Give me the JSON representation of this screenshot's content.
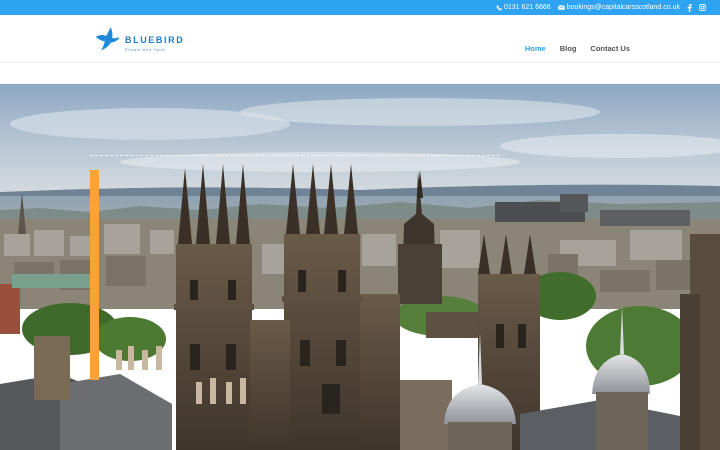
{
  "topbar": {
    "phone": "0131 621 6666",
    "email": "bookings@capitalcarsscotland.co.uk",
    "icons": [
      "phone-icon",
      "mail-icon",
      "facebook-icon",
      "instagram-icon"
    ]
  },
  "logo": {
    "name": "BLUEBIRD",
    "tagline": "Private Hire Taxis"
  },
  "nav": {
    "items": [
      {
        "label": "Home",
        "active": true
      },
      {
        "label": "Blog",
        "active": false
      },
      {
        "label": "Contact Us",
        "active": false
      }
    ]
  },
  "colors": {
    "primary": "#2ea3f2",
    "accent": "#f7a33a",
    "nav_text": "#555555"
  }
}
